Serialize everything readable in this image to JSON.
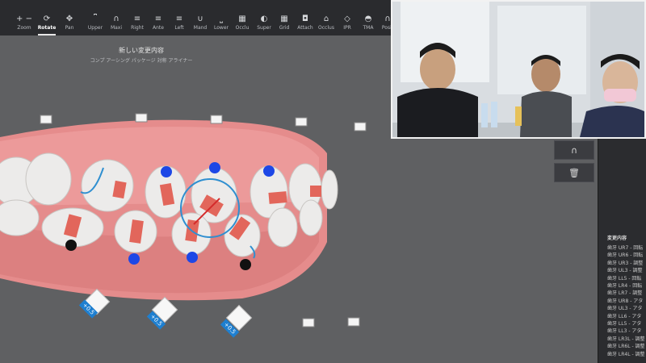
{
  "toolbar": {
    "tools": [
      {
        "label": "Zoom",
        "icon": "+ −"
      },
      {
        "label": "Rotate",
        "icon": "⟳"
      },
      {
        "label": "Pan",
        "icon": "✥"
      },
      {
        "label": "Upper",
        "icon": "⎴"
      },
      {
        "label": "Maxi",
        "icon": "∩"
      },
      {
        "label": "Right",
        "icon": "≡"
      },
      {
        "label": "Ante",
        "icon": "≡"
      },
      {
        "label": "Left",
        "icon": "≡"
      },
      {
        "label": "Mand",
        "icon": "∪"
      },
      {
        "label": "Lower",
        "icon": "⎵"
      },
      {
        "label": "Occlu",
        "icon": "▦"
      },
      {
        "label": "Super",
        "icon": "◐"
      },
      {
        "label": "Grid",
        "icon": "▦"
      },
      {
        "label": "Attach",
        "icon": "◘"
      },
      {
        "label": "Occlus",
        "icon": "⌂"
      },
      {
        "label": "IPR",
        "icon": "◇"
      },
      {
        "label": "TMA",
        "icon": "◓"
      },
      {
        "label": "Posit",
        "icon": "∩"
      }
    ]
  },
  "viewport": {
    "title": "新しい変更内容",
    "subtitle": "コンプ アーシング パッケージ 対称 アライナー",
    "ipr_labels": [
      "+0.5",
      "+0.5",
      "+0.5"
    ]
  },
  "right_panel": {
    "arch_icon": "∩",
    "trash_icon": "🗑",
    "list_title": "変更内容",
    "items": [
      "歯牙 UR7 - 回転",
      "歯牙 UR6 - 回転",
      "歯牙 UR3 - 調整",
      "歯牙 UL3 - 調整",
      "歯牙 LL5 - 回転",
      "歯牙 LR4 - 回転",
      "歯牙 LR7 - 調整",
      "歯牙 UR8 - アタ",
      "歯牙 UL3 - アタ",
      "歯牙 LL6 - アタ",
      "歯牙 LL5 - アタ",
      "歯牙 LL3 - アタ",
      "歯牙 LR3L - 調整",
      "歯牙 LR6L - 調整",
      "歯牙 LR4L - 調整"
    ]
  }
}
